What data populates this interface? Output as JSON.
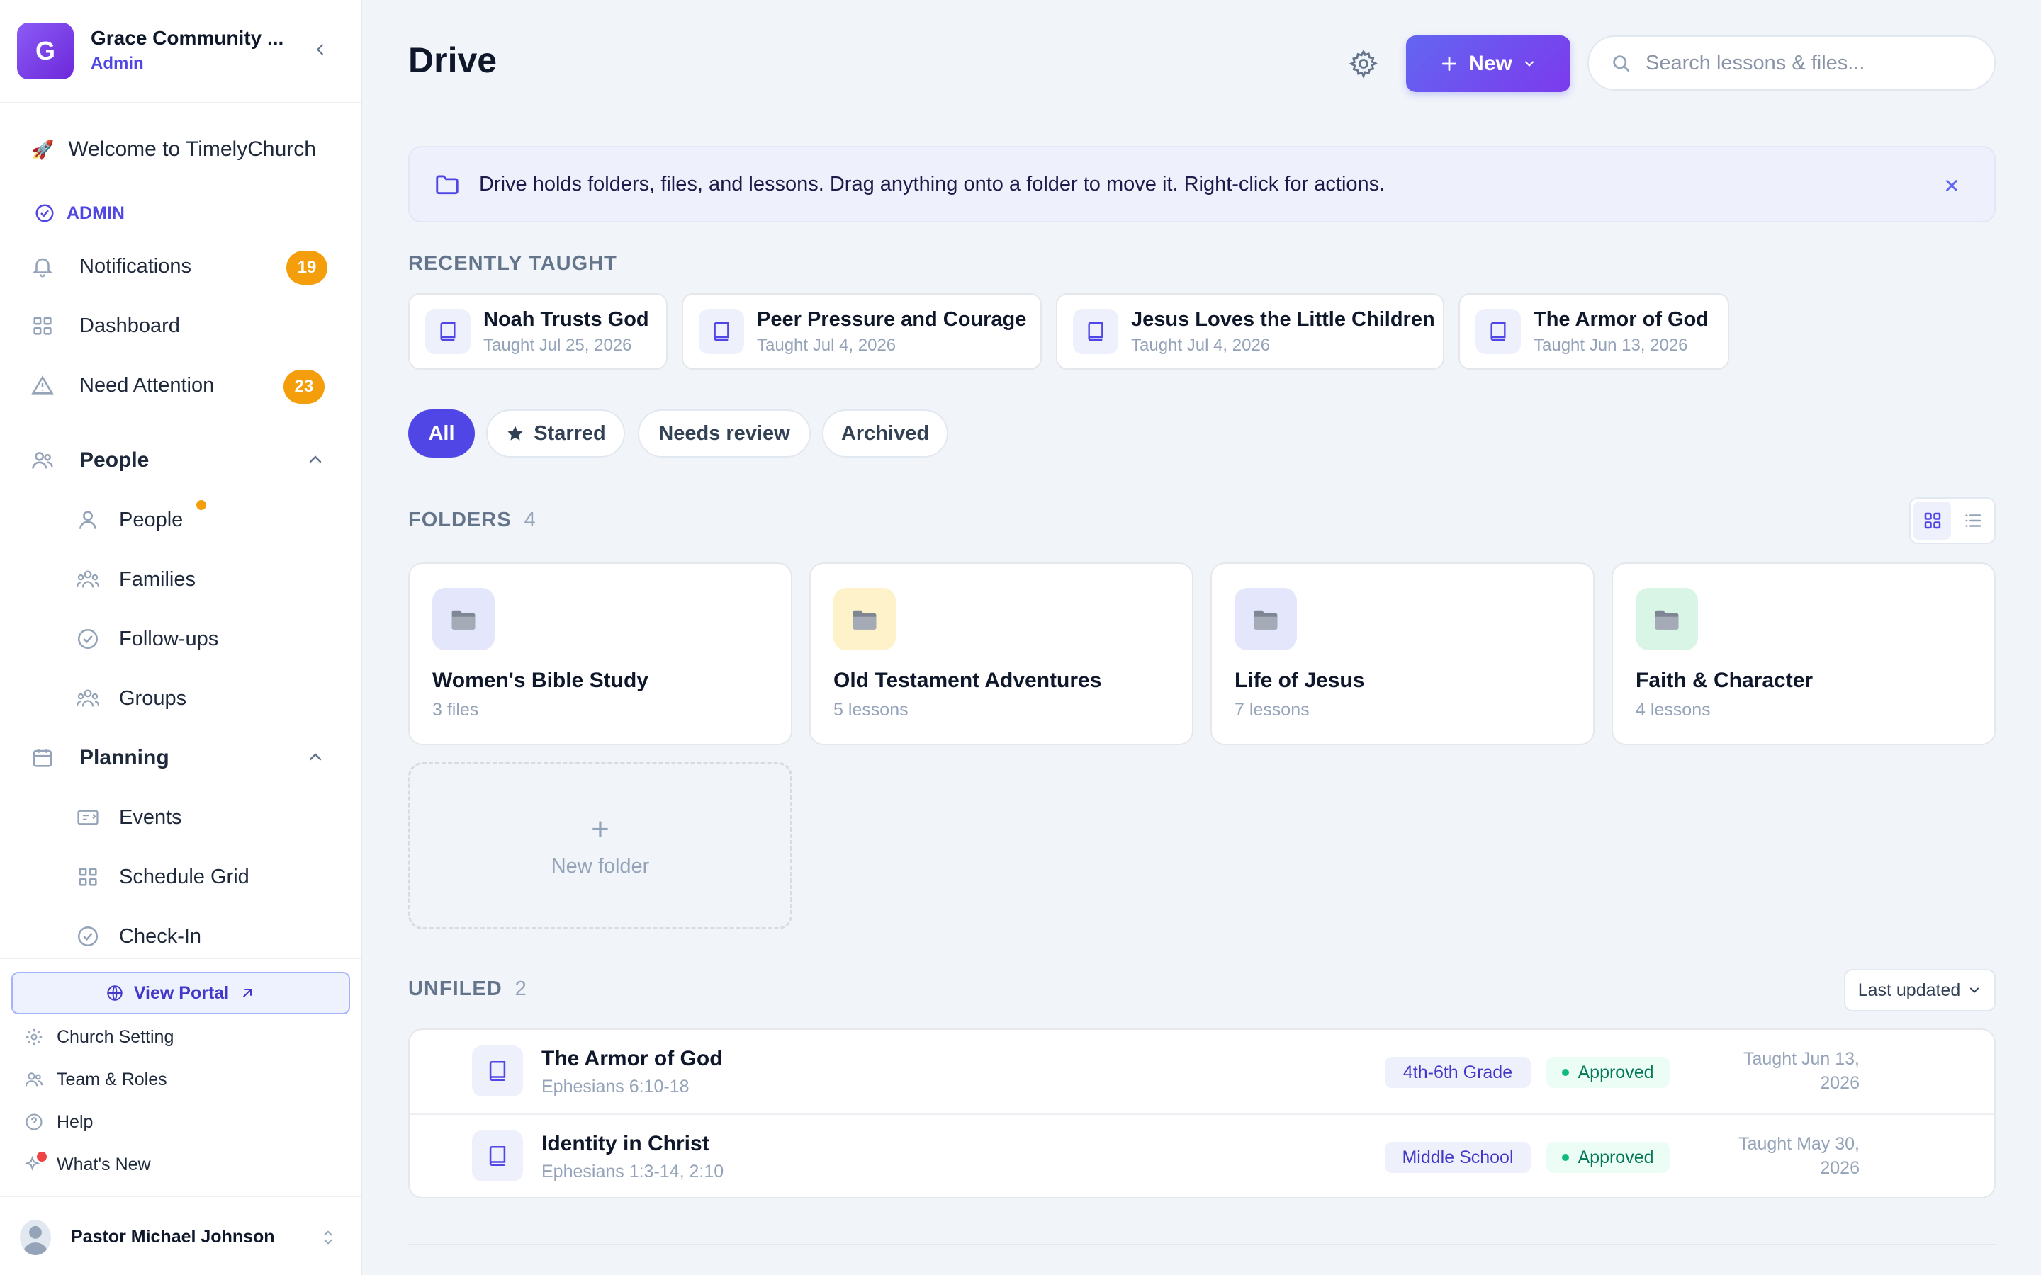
{
  "org": {
    "initial": "G",
    "name": "Grace Community ...",
    "role": "Admin"
  },
  "sidebar": {
    "welcome": "Welcome to TimelyChurch",
    "welcome_emoji": "🚀",
    "section_label": "ADMIN",
    "items": [
      {
        "label": "Notifications",
        "icon": "bell-icon",
        "badge": "19"
      },
      {
        "label": "Dashboard",
        "icon": "grid-icon"
      },
      {
        "label": "Need Attention",
        "icon": "warning-icon",
        "badge": "23"
      }
    ],
    "people_group": {
      "label": "People",
      "icon": "users-icon",
      "items": [
        {
          "label": "People",
          "icon": "user-icon",
          "dot": true
        },
        {
          "label": "Families",
          "icon": "family-icon"
        },
        {
          "label": "Follow-ups",
          "icon": "check-circle-icon"
        },
        {
          "label": "Groups",
          "icon": "groups-icon"
        }
      ]
    },
    "planning_group": {
      "label": "Planning",
      "icon": "calendar-icon",
      "items": [
        {
          "label": "Events",
          "icon": "ticket-icon"
        },
        {
          "label": "Schedule Grid",
          "icon": "grid-icon"
        },
        {
          "label": "Check-In",
          "icon": "check-circle-icon"
        }
      ]
    },
    "portal_button": "View Portal",
    "bottom_links": [
      {
        "label": "Church Setting",
        "icon": "gear-icon"
      },
      {
        "label": "Team & Roles",
        "icon": "users-icon"
      },
      {
        "label": "Help",
        "icon": "help-icon"
      },
      {
        "label": "What's New",
        "icon": "sparkle-icon"
      }
    ],
    "user_name": "Pastor Michael Johnson"
  },
  "header": {
    "title": "Drive",
    "new_button": "New",
    "search_placeholder": "Search lessons & files..."
  },
  "banner": {
    "text": "Drive holds folders, files, and lessons. Drag anything onto a folder to move it. Right-click for actions."
  },
  "recently_taught": {
    "label": "RECENTLY TAUGHT",
    "items": [
      {
        "title": "Noah Trusts God",
        "sub": "Taught Jul 25, 2026"
      },
      {
        "title": "Peer Pressure and Courage",
        "sub": "Taught Jul 4, 2026"
      },
      {
        "title": "Jesus Loves the Little Children",
        "sub": "Taught Jul 4, 2026"
      },
      {
        "title": "The Armor of God",
        "sub": "Taught Jun 13, 2026"
      }
    ]
  },
  "filters": {
    "all": "All",
    "starred": "Starred",
    "needs_review": "Needs review",
    "archived": "Archived"
  },
  "folders": {
    "label": "FOLDERS",
    "count": "4",
    "items": [
      {
        "name": "Women's Bible Study",
        "sub": "3 files",
        "color": "#e4e7fb"
      },
      {
        "name": "Old Testament Adventures",
        "sub": "5 lessons",
        "color": "#fdf2c9"
      },
      {
        "name": "Life of Jesus",
        "sub": "7 lessons",
        "color": "#e4e7fb"
      },
      {
        "name": "Faith & Character",
        "sub": "4 lessons",
        "color": "#d9f5e6"
      }
    ],
    "new_folder": "New folder"
  },
  "unfiled": {
    "label": "UNFILED",
    "count": "2",
    "sort": "Last updated",
    "rows": [
      {
        "title": "The Armor of God",
        "sub": "Ephesians 6:10-18",
        "tag": "4th-6th Grade",
        "status": "Approved",
        "taught_1": "Taught Jun 13,",
        "taught_2": "2026"
      },
      {
        "title": "Identity in Christ",
        "sub": "Ephesians 1:3-14, 2:10",
        "tag": "Middle School",
        "status": "Approved",
        "taught_1": "Taught May 30,",
        "taught_2": "2026"
      }
    ]
  },
  "colors": {
    "accent": "#4f46e5",
    "badge": "#f59e0b",
    "approved": "#047857"
  }
}
